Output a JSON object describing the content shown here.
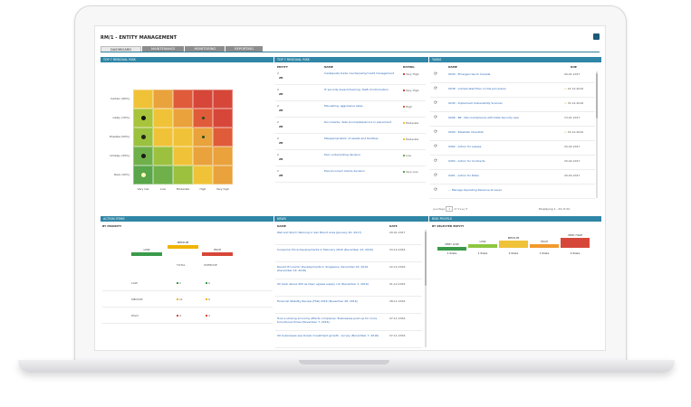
{
  "app": {
    "title": "RM/1 - ENTITY MANAGEMENT",
    "tabs": [
      "DASHBOARD",
      "MAINTENANCE",
      "MONITORING",
      "REPORTING"
    ]
  },
  "panels": {
    "residual_risk": "TOP 7 RESIDUAL RISK",
    "residual_list": "TOP 7 RESIDUAL RISK",
    "tasks": "TASKS",
    "action_items": "ACTION ITEMS",
    "news": "NEWS",
    "risk_profile": "RISK PROFILE"
  },
  "heatmap": {
    "y_labels": [
      "Certain (90%)",
      "Likely (70%)",
      "Possible (50%)",
      "Unlikely (30%)",
      "Rare (10%)"
    ],
    "x_labels": [
      "Very low",
      "Low",
      "Moderate",
      "High",
      "Very high"
    ],
    "colors": [
      [
        "#f0c238",
        "#e9a23c",
        "#e05b3a",
        "#d6473a",
        "#d6473a"
      ],
      [
        "#a8c43b",
        "#f0c238",
        "#e9a23c",
        "#e05b3a",
        "#d6473a"
      ],
      [
        "#9bc13f",
        "#f0c238",
        "#f0c238",
        "#e9a23c",
        "#e05b3a"
      ],
      [
        "#6fb04a",
        "#9bc13f",
        "#f0c238",
        "#e9a23c",
        "#e9a23c"
      ],
      [
        "#5aa64a",
        "#6fb04a",
        "#9bc13f",
        "#f0c238",
        "#e9a23c"
      ]
    ]
  },
  "residual": {
    "headers": [
      "ENTITY",
      "NAME",
      "RATING"
    ],
    "rows": [
      {
        "entity": "ZB",
        "name": "Inadequate trade counterparty/credit management",
        "rating": "Very High",
        "color": "#d6473a"
      },
      {
        "entity": "ZB",
        "name": "IT security breach/hacking, theft of information",
        "rating": "Very High",
        "color": "#d6473a"
      },
      {
        "entity": "ZB",
        "name": "Mis-selling, aggressive sales",
        "rating": "High",
        "color": "#e05b3a"
      },
      {
        "entity": "ZB",
        "name": "Documents, data incomplete/errors in placement",
        "rating": "Moderate",
        "color": "#f0c238"
      },
      {
        "entity": "ZB",
        "name": "Misappropriation of assets and facilities",
        "rating": "Moderate",
        "color": "#f0c238"
      },
      {
        "entity": "ZB",
        "name": "Poor underwriting decision",
        "rating": "Low",
        "color": "#6fb04a"
      },
      {
        "entity": "ZB",
        "name": "Poor/incorrect claims decision",
        "rating": "Very Low",
        "color": "#5aa64a"
      }
    ]
  },
  "tasks": {
    "headers": [
      "NAME",
      "DUE"
    ],
    "rows": [
      {
        "name": "0030 - Emergencies to Canada",
        "due": "09-01-2017",
        "warn": false
      },
      {
        "name": "0038 - Complicated Plan on the procedure",
        "due": "21-12-2016",
        "warn": true
      },
      {
        "name": "0245 - Implement Vulnerability Scanner",
        "due": "31-12-2016",
        "warn": true
      },
      {
        "name": "0006 - BP - Non-Compliance with Data Security Law",
        "due": "13-01-2017",
        "warn": false
      },
      {
        "name": "0009 - Establish Checklist",
        "due": "23-12-2016",
        "warn": true
      },
      {
        "name": "0402 - Action for Leases",
        "due": "20-02-2017",
        "warn": false
      },
      {
        "name": "0403 - Action for Contracts",
        "due": "20-02-2017",
        "warn": false
      },
      {
        "name": "0401 - Action for Risks",
        "due": "20-02-2017",
        "warn": false
      },
      {
        "name": "... Manage Operating Revenue at Level",
        "due": "",
        "warn": false
      }
    ],
    "pager": {
      "page": "Page",
      "page_num": "1",
      "of": "of 3",
      "displaying": "Displaying 1 - 22 of 22"
    }
  },
  "action_items": {
    "subheader": "BY PRIORITY",
    "legend": [
      "LOW",
      "MEDIUM",
      "HIGH"
    ],
    "legend_colors": [
      "#3a9a4a",
      "#f0b400",
      "#d6473a"
    ],
    "cols": [
      "TOTAL",
      "OVERDUE"
    ],
    "rows": [
      {
        "label": "LOW",
        "total": "2",
        "overdue": "0",
        "color": "#3a9a4a"
      },
      {
        "label": "MEDIUM",
        "total": "11",
        "overdue": "0",
        "color": "#f0b400"
      },
      {
        "label": "HIGH",
        "total": "4",
        "overdue": "3",
        "color": "#d6473a"
      }
    ]
  },
  "news": {
    "headers": [
      "NAME",
      "DATE"
    ],
    "rows": [
      {
        "name": "Wet and Storm Warning in San Mount Area (January 20, 2017)",
        "date": "20-01-2017"
      },
      {
        "name": "Consumer Price Developments in February 2016 (December 23, 2016)",
        "date": "23-12-2016"
      },
      {
        "name": "Recent Economic Developments in Singapore, December 22, 2016 (December 22, 2016)",
        "date": "22-12-2016"
      },
      {
        "name": "Oil back above $50 as Opec agrees supply cut (December 1, 2016)",
        "date": "01-12-2016"
      },
      {
        "name": "Financial Stability Review (FSR) 2016 (November 28, 2016)",
        "date": "28-11-2016"
      },
      {
        "name": "How a slowing economy affects companies: Businesses push up for more tumultuous times (November 7, 2016)",
        "date": "07-11-2016"
      },
      {
        "name": "UK businesses see slower investment growth - survey (November 7, 2016)",
        "date": "07-11-2016"
      }
    ]
  },
  "risk_profile": {
    "subheader": "BY SELECTED ENTITY",
    "categories": [
      "VERY LOW",
      "LOW",
      "MEDIUM",
      "HIGH",
      "VERY HIGH"
    ],
    "colors": [
      "#3a9a4a",
      "#8dc63f",
      "#f0c238",
      "#f29a2e",
      "#d6473a"
    ],
    "counts": [
      "1 Risks",
      "1 Risks",
      "2 Risks",
      "1 Risks",
      "2 Risks"
    ]
  }
}
